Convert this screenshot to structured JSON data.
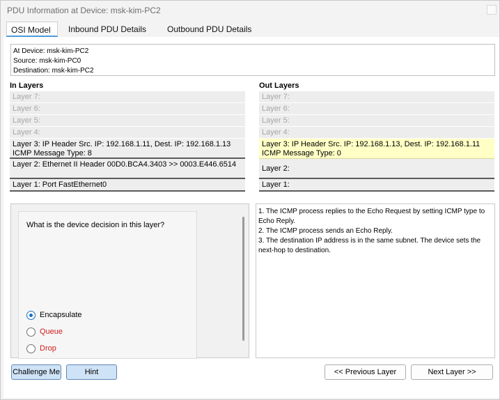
{
  "window": {
    "title": "PDU Information at Device: msk-kim-PC2"
  },
  "tabs": [
    "OSI Model",
    "Inbound PDU Details",
    "Outbound PDU Details"
  ],
  "device_info": [
    "At Device: msk-kim-PC2",
    "Source: msk-kim-PC0",
    "Destination: msk-kim-PC2"
  ],
  "in_layers": {
    "header": "In Layers",
    "layers": [
      "Layer 7:",
      "Layer 6:",
      "Layer 5:",
      "Layer 4:",
      "Layer 3: IP Header Src. IP: 192.168.1.11, Dest. IP: 192.168.1.13 ICMP Message Type: 8",
      "Layer 2: Ethernet II Header 00D0.BCA4.3403 >> 0003.E446.6514",
      "Layer 1: Port FastEthernet0"
    ]
  },
  "out_layers": {
    "header": "Out Layers",
    "layers": [
      "Layer 7:",
      "Layer 6:",
      "Layer 5:",
      "Layer 4:",
      "Layer 3: IP Header Src. IP: 192.168.1.13, Dest. IP: 192.168.1.11 ICMP Message Type: 0",
      "Layer 2:",
      "Layer 1:"
    ]
  },
  "question": {
    "text": "What is the device decision in this layer?",
    "options": [
      {
        "label": "Encapsulate",
        "selected": true,
        "color": "#000000"
      },
      {
        "label": "Queue",
        "selected": false,
        "color": "#d01c1c"
      },
      {
        "label": "Drop",
        "selected": false,
        "color": "#d01c1c"
      }
    ]
  },
  "explanation": [
    "1. The ICMP process replies to the Echo Request by setting ICMP type to Echo Reply.",
    "2. The ICMP process sends an Echo Reply.",
    "3. The destination IP address is in the same subnet. The device sets the next-hop to destination."
  ],
  "buttons": {
    "challenge": "Challenge Me",
    "hint": "Hint",
    "previous": "<< Previous Layer",
    "next": "Next Layer >>"
  },
  "colors": {
    "highlight": "#ffffc6",
    "accent": "#1a6fbf",
    "warning": "#d01c1c"
  }
}
